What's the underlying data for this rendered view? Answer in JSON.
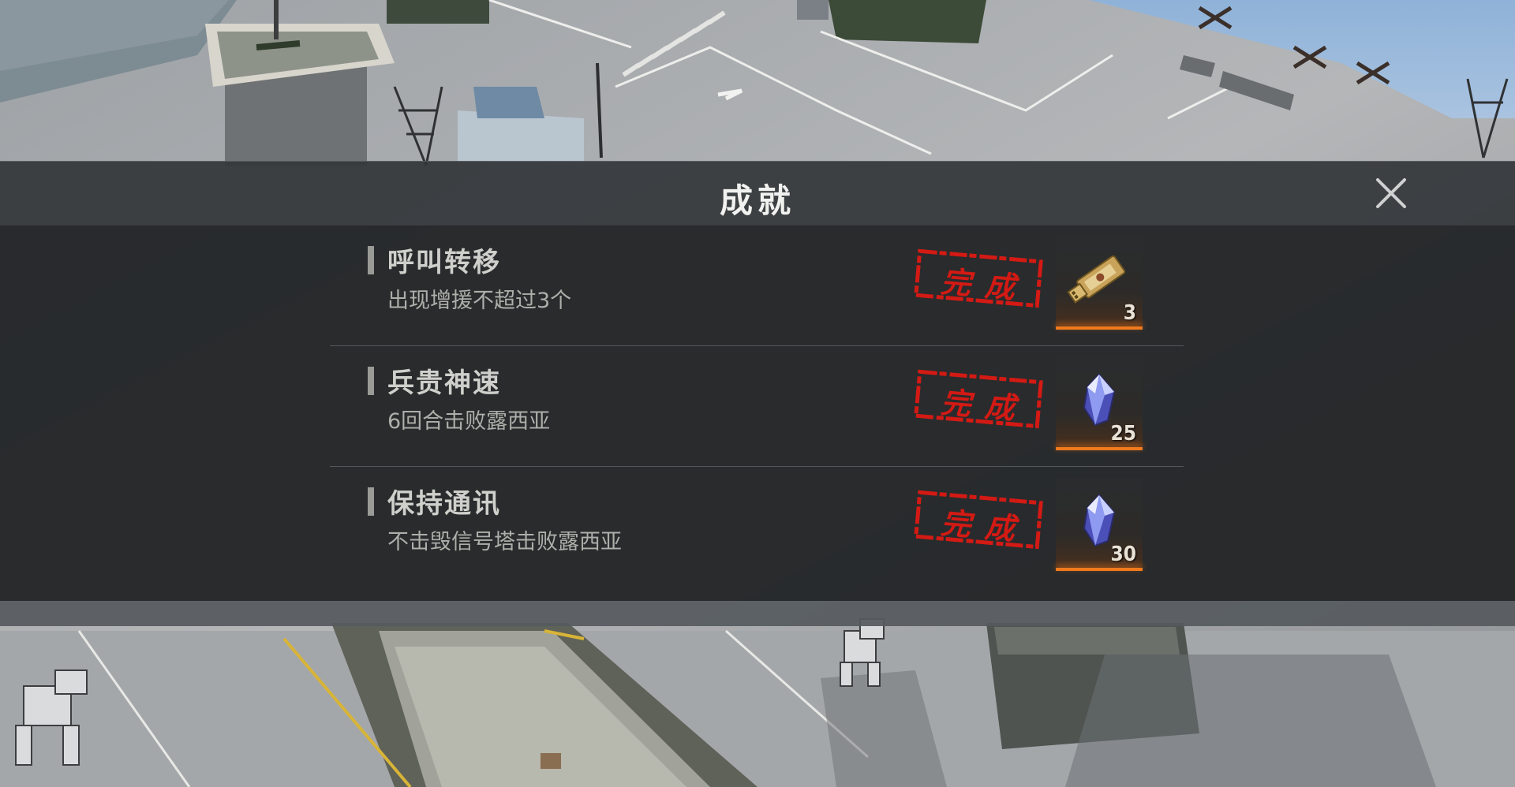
{
  "modal": {
    "title": "成就",
    "close_icon": "close-icon"
  },
  "achievements": [
    {
      "name": "呼叫转移",
      "description": "出现增援不超过3个",
      "status": "完成",
      "reward": {
        "icon": "usb-key-icon",
        "count": "3"
      }
    },
    {
      "name": "兵贵神速",
      "description": "6回合击败露西亚",
      "status": "完成",
      "reward": {
        "icon": "crystal-icon",
        "count": "25"
      }
    },
    {
      "name": "保持通讯",
      "description": "不击毁信号塔击败露西亚",
      "status": "完成",
      "reward": {
        "icon": "crystal-icon",
        "count": "30"
      }
    }
  ],
  "colors": {
    "stamp_red": "#d31a14",
    "reward_glow": "#f07a1d",
    "panel_bg": "#242628",
    "header_bg": "#34373a"
  }
}
